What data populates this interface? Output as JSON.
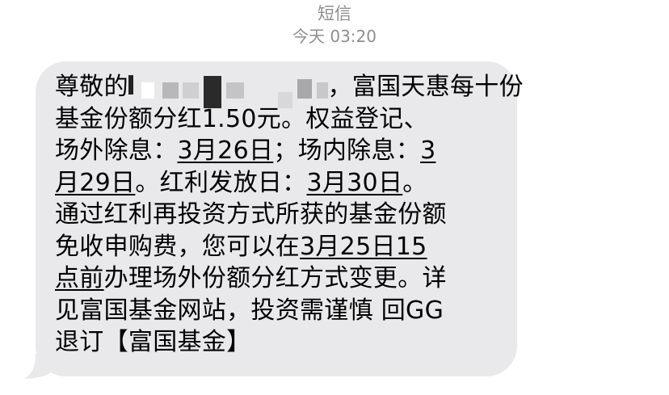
{
  "header": {
    "service": "短信",
    "time": "今天 03:20"
  },
  "message": {
    "greeting": "尊敬的",
    "line1_rest": "，富国天惠每十份",
    "line2": "基金份额分红1.50元。权益登记、",
    "line3_a": "场外除息：",
    "line3_link": "3月26日",
    "line3_b": "；场内除息：",
    "line3_link2": "3",
    "line4_link": "月29日",
    "line4_b": "。红利发放日：",
    "line4_link2": "3月30日",
    "line4_c": "。",
    "line5": "通过红利再投资方式所获的基金份额",
    "line6_a": "免收申购费，您可以在",
    "line6_link": "3月25日15",
    "line7_link": "点前",
    "line7_b": "办理场外份额分红方式变更。详",
    "line8": "见富国基金网站，投资需谨慎 回GG",
    "line9": "退订【富国基金】"
  },
  "colors": {
    "bubble": "#e9e9eb",
    "meta_text": "#8e8e93",
    "text": "#000000"
  }
}
